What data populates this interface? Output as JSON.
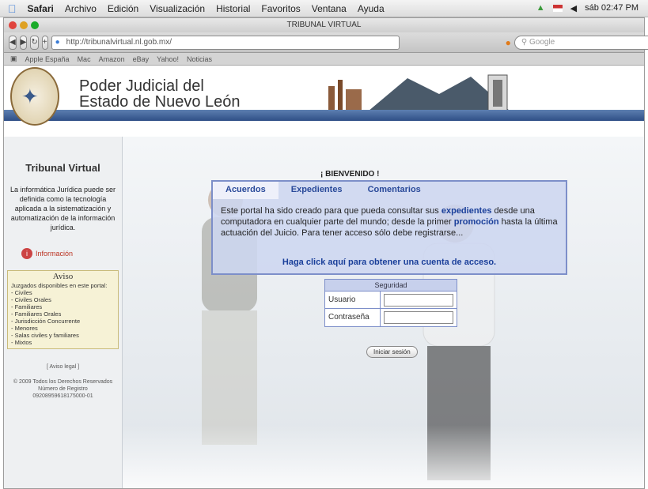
{
  "menubar": {
    "app": "Safari",
    "items": [
      "Archivo",
      "Edición",
      "Visualización",
      "Historial",
      "Favoritos",
      "Ventana",
      "Ayuda"
    ],
    "clock": "sáb 02:47 PM"
  },
  "browser": {
    "window_title": "TRIBUNAL VIRTUAL",
    "url": "http://tribunalvirtual.nl.gob.mx/",
    "search_placeholder": "Google",
    "bookmarks": [
      "Apple España",
      "Mac",
      "Amazon",
      "eBay",
      "Yahoo!",
      "Noticias"
    ]
  },
  "header": {
    "title_line1": "Poder Judicial del",
    "title_line2": "Estado de Nuevo León"
  },
  "sidebar": {
    "title": "Tribunal Virtual",
    "description": "La informática Jurídica puede ser definida como la tecnología aplicada a la sistematización y automatización de la información jurídica.",
    "info_link": "Información",
    "aviso": {
      "title": "Aviso",
      "intro": "Juzgados disponibles en este portal:",
      "items": [
        "- Civiles",
        "- Civiles Orales",
        "- Familiares",
        "- Familiares Orales",
        "- Jurisdicción Concurrente",
        "- Menores",
        "- Salas civiles y familiares",
        "- Mixtos"
      ]
    },
    "footer": {
      "legal_link": "[ Aviso legal ]",
      "copyright": "© 2009 Todos los Derechos Reservados",
      "registro_label": "Número de Registro",
      "registro": "09208959618175000-01"
    }
  },
  "welcome": {
    "heading": "¡ BIENVENIDO !",
    "tabs": [
      "Acuerdos",
      "Expedientes",
      "Comentarios"
    ],
    "text_a": "Este portal ha sido creado para que pueda consultar sus ",
    "text_b": "expedientes",
    "text_c": " desde una computadora en cualquier parte del mundo; desde la primer ",
    "text_d": "promoción",
    "text_e": " hasta la última actuación del Juicio. Para tener acceso sólo debe registrarse...",
    "link": "Haga click aquí para obtener una cuenta de acceso."
  },
  "login": {
    "header": "Seguridad",
    "user_label": "Usuario",
    "password_label": "Contraseña",
    "button": "Iniciar sesión"
  }
}
